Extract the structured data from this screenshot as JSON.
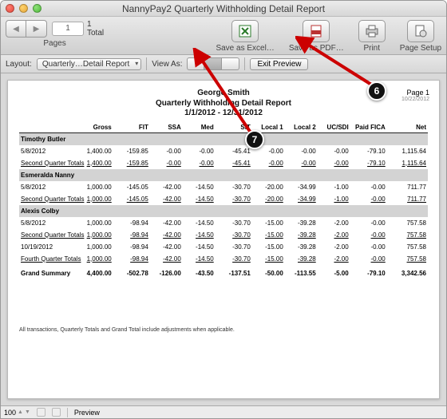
{
  "window": {
    "title": "NannyPay2 Quarterly Withholding Detail Report"
  },
  "toolbar": {
    "page_current": "1",
    "total_num": "1",
    "total_label": "Total",
    "pages_label": "Pages",
    "save_excel": "Save as Excel…",
    "save_pdf": "Save as PDF…",
    "print": "Print",
    "page_setup": "Page Setup"
  },
  "layoutbar": {
    "layout_label": "Layout:",
    "layout_value": "Quarterly…Detail Report",
    "viewas_label": "View As:",
    "exit_label": "Exit Preview"
  },
  "report": {
    "header_name": "George Smith",
    "header_title": "Quarterly Withholding Detail Report",
    "header_range": "1/1/2012 - 12/31/2012",
    "page_label": "Page 1",
    "page_date": "10/22/2012",
    "columns": [
      "",
      "Gross",
      "FIT",
      "SSA",
      "Med",
      "SIT",
      "Local 1",
      "Local 2",
      "UC/SDI",
      "Paid FICA",
      "Net"
    ],
    "sections": [
      {
        "employee": "Timothy Butler",
        "rows": [
          {
            "label": "5/8/2012",
            "vals": [
              "1,400.00",
              "-159.85",
              "-0.00",
              "-0.00",
              "-45.41",
              "-0.00",
              "-0.00",
              "-0.00",
              "-79.10",
              "1,115.64"
            ]
          }
        ],
        "total": {
          "label": "Second Quarter  Totals",
          "vals": [
            "1,400.00",
            "-159.85",
            "-0.00",
            "-0.00",
            "-45.41",
            "-0.00",
            "-0.00",
            "-0.00",
            "-79.10",
            "1,115.64"
          ]
        }
      },
      {
        "employee": "Esmeralda Nanny",
        "rows": [
          {
            "label": "5/8/2012",
            "vals": [
              "1,000.00",
              "-145.05",
              "-42.00",
              "-14.50",
              "-30.70",
              "-20.00",
              "-34.99",
              "-1.00",
              "-0.00",
              "711.77"
            ]
          }
        ],
        "total": {
          "label": "Second Quarter  Totals",
          "vals": [
            "1,000.00",
            "-145.05",
            "-42.00",
            "-14.50",
            "-30.70",
            "-20.00",
            "-34.99",
            "-1.00",
            "-0.00",
            "711.77"
          ]
        }
      },
      {
        "employee": "Alexis Colby",
        "rows": [
          {
            "label": "5/8/2012",
            "vals": [
              "1,000.00",
              "-98.94",
              "-42.00",
              "-14.50",
              "-30.70",
              "-15.00",
              "-39.28",
              "-2.00",
              "-0.00",
              "757.58"
            ]
          }
        ],
        "total": {
          "label": "Second Quarter  Totals",
          "vals": [
            "1,000.00",
            "-98.94",
            "-42.00",
            "-14.50",
            "-30.70",
            "-15.00",
            "-39.28",
            "-2.00",
            "-0.00",
            "757.58"
          ]
        },
        "rows2": [
          {
            "label": "10/19/2012",
            "vals": [
              "1,000.00",
              "-98.94",
              "-42.00",
              "-14.50",
              "-30.70",
              "-15.00",
              "-39.28",
              "-2.00",
              "-0.00",
              "757.58"
            ]
          }
        ],
        "total2": {
          "label": "Fourth Quarter  Totals",
          "vals": [
            "1,000.00",
            "-98.94",
            "-42.00",
            "-14.50",
            "-30.70",
            "-15.00",
            "-39.28",
            "-2.00",
            "-0.00",
            "757.58"
          ]
        }
      }
    ],
    "grand": {
      "label": "Grand Summary",
      "vals": [
        "4,400.00",
        "-502.78",
        "-126.00",
        "-43.50",
        "-137.51",
        "-50.00",
        "-113.55",
        "-5.00",
        "-79.10",
        "3,342.56"
      ]
    },
    "footnote": "All transactions, Quarterly Totals and Grand Total include adjustments when applicable."
  },
  "status": {
    "zoom": "100",
    "mode": "Preview"
  },
  "callouts": {
    "c6": "6",
    "c7": "7"
  }
}
